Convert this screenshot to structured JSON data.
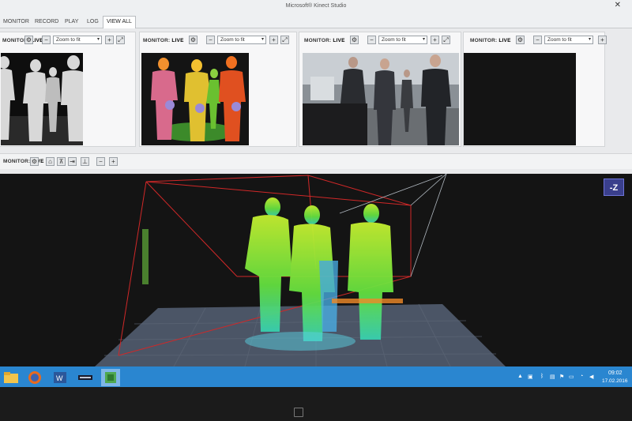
{
  "window": {
    "title": "Microsoft® Kinect Studio",
    "close_label": "✕"
  },
  "nav": {
    "tabs": [
      {
        "label": "MONITOR",
        "active": false
      },
      {
        "label": "RECORD",
        "active": false
      },
      {
        "label": "PLAY",
        "active": false
      },
      {
        "label": "LOG",
        "active": false
      },
      {
        "label": "VIEW ALL",
        "active": true
      }
    ]
  },
  "panels": [
    {
      "label_prefix": "MONITOR:",
      "label_status": "LIVE",
      "zoom": "Zoom to fit",
      "stream": "depth"
    },
    {
      "label_prefix": "MONITOR:",
      "label_status": "LIVE",
      "zoom": "Zoom to fit",
      "stream": "body-index"
    },
    {
      "label_prefix": "MONITOR:",
      "label_status": "LIVE",
      "zoom": "Zoom to fit",
      "stream": "color"
    },
    {
      "label_prefix": "MONITOR:",
      "label_status": "LIVE",
      "zoom": "Zoom to fit",
      "stream": "blank"
    }
  ],
  "viewer3d": {
    "label_prefix": "MONITOR:",
    "label_status": "LIVE",
    "z_badge": "-Z"
  },
  "taskbar": {
    "apps": [
      "file-explorer-icon",
      "firefox-icon",
      "word-icon",
      "media-icon",
      "kinect-studio-icon"
    ],
    "time": "09:02",
    "date": "17.02.2016"
  },
  "icons": {
    "gear": "⚙",
    "minus": "−",
    "plus": "+",
    "fit": "⤢",
    "caret": "▾"
  },
  "colors": {
    "accent": "#2a86d0",
    "viewer_bg": "#141414",
    "cloud_green": "#8cf026"
  }
}
